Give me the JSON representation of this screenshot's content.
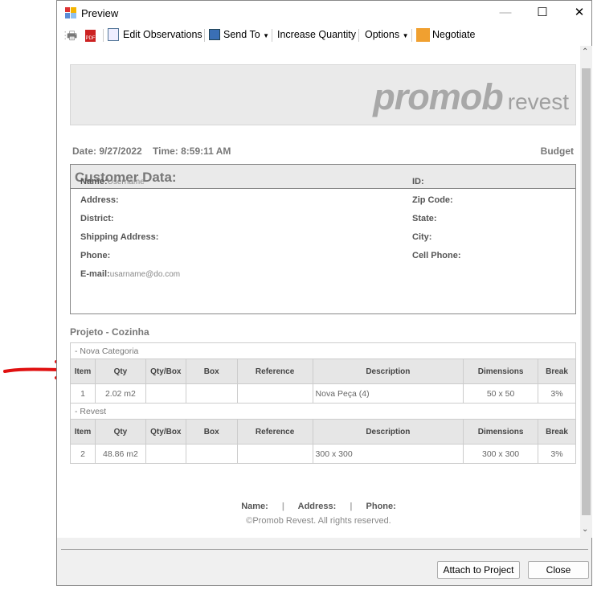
{
  "window": {
    "title": "Preview"
  },
  "toolbar": {
    "edit_observations": "Edit Observations",
    "send_to": "Send To",
    "increase_quantity": "Increase Quantity",
    "options": "Options",
    "negotiate": "Negotiate"
  },
  "report": {
    "logo": "promob",
    "logo_sub": "revest",
    "date": "Date: 9/27/2022",
    "time": "Time: 8:59:11 AM",
    "doc_type": "Budget",
    "customer_title": "Customer Data:",
    "fields_left": [
      {
        "label": "Name:",
        "value": "Username"
      },
      {
        "label": "Address:",
        "value": ""
      },
      {
        "label": "District:",
        "value": ""
      },
      {
        "label": "Shipping Address:",
        "value": ""
      },
      {
        "label": "Phone:",
        "value": ""
      },
      {
        "label": "E-mail:",
        "value": "usarname@do.com"
      }
    ],
    "fields_right": [
      {
        "label": "ID:"
      },
      {
        "label": "Zip Code:"
      },
      {
        "label": "State:"
      },
      {
        "label": "City:"
      },
      {
        "label": "Cell Phone:"
      }
    ],
    "project_title": "Projeto - Cozinha",
    "columns": [
      "Item",
      "Qty",
      "Qty/Box",
      "Box",
      "Reference",
      "Description",
      "Dimensions",
      "Break"
    ],
    "groups": [
      {
        "category": "- Nova Categoria",
        "row": [
          "1",
          "2.02 m2",
          "",
          "",
          "",
          "Nova Peça (4)",
          "50 x 50",
          "3%"
        ]
      },
      {
        "category": "- Revest",
        "row": [
          "2",
          "48.86 m2",
          "",
          "",
          "",
          "300 x 300",
          "300 x 300",
          "3%"
        ]
      }
    ],
    "footer_name": "Name:",
    "footer_address": "Address:",
    "footer_phone": "Phone:",
    "footer_sep": "|",
    "copyright": "©Promob Revest. All rights reserved."
  },
  "buttons": {
    "attach": "Attach to Project",
    "close": "Close"
  },
  "annotation": {
    "arrow_color": "#e01010"
  }
}
